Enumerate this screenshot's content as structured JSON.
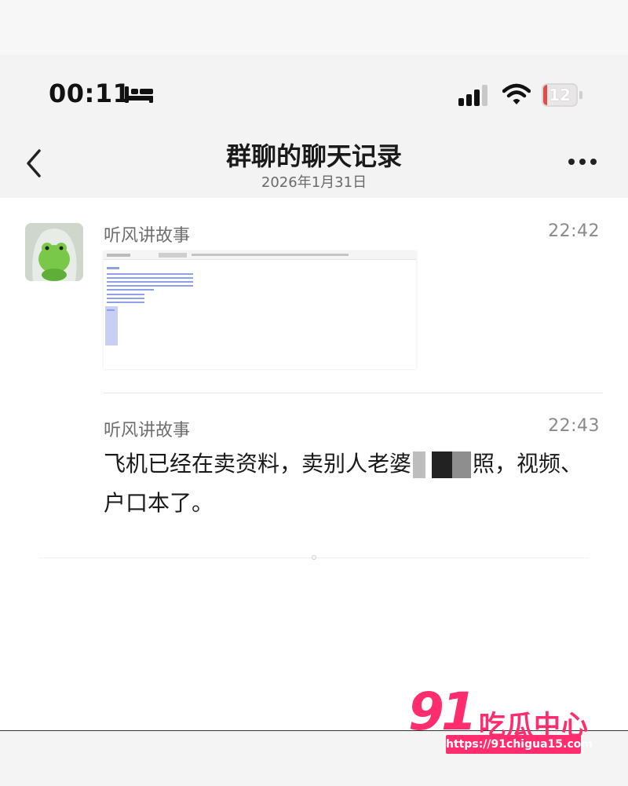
{
  "status_bar": {
    "time": "00:11",
    "battery_level": "12",
    "battery_fraction": 0.12
  },
  "nav": {
    "title": "群聊的聊天记录",
    "subtitle": "2026年1月31日"
  },
  "messages": [
    {
      "sender": "听风讲故事",
      "time": "22:42",
      "type": "image"
    },
    {
      "sender": "听风讲故事",
      "time": "22:43",
      "text_a": "飞机已经在卖资料，卖别人老婆",
      "text_b": "照，视频、户口本了。"
    }
  ],
  "watermark": {
    "number": "91",
    "name": "吃瓜中心",
    "url": "https://91chigua15.com"
  },
  "colors": {
    "accent": "#ff2d6e",
    "battery_low": "#e34b4b"
  },
  "icons": [
    "bed-icon",
    "signal-icon",
    "wifi-icon",
    "battery-icon",
    "back-chevron-icon",
    "more-dots-icon"
  ]
}
